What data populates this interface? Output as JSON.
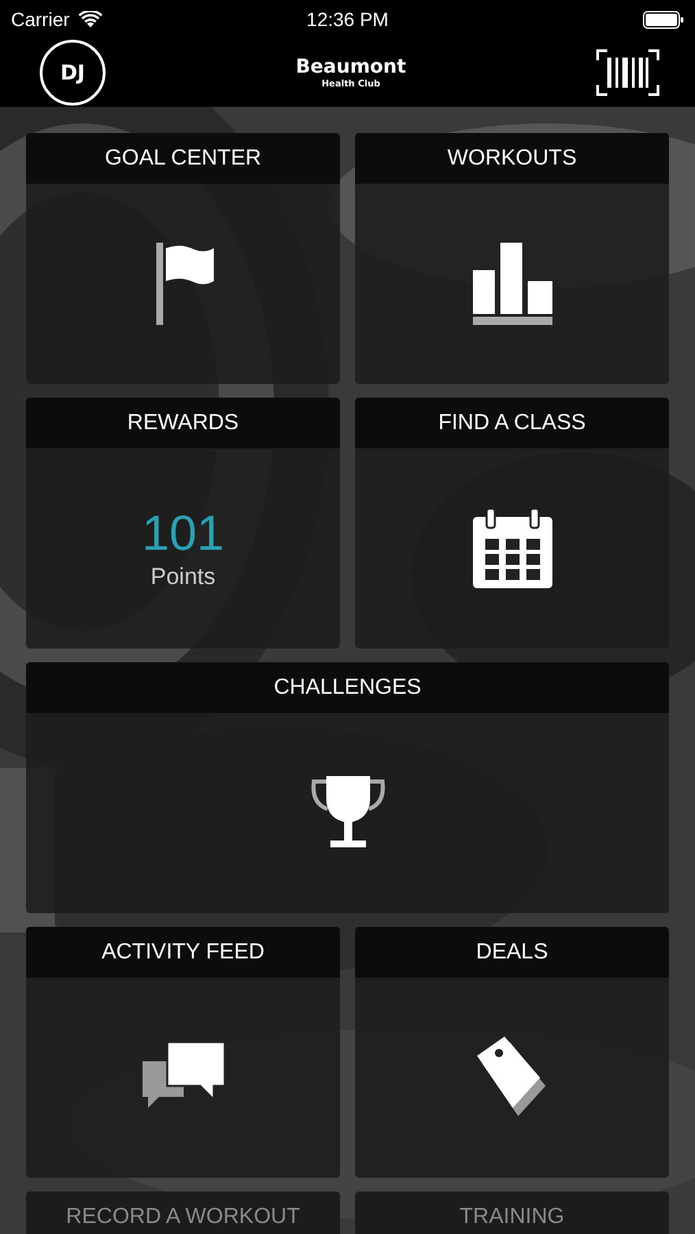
{
  "status_bar": {
    "carrier": "Carrier",
    "time": "12:36 PM"
  },
  "nav_bar": {
    "avatar": "DJ",
    "title": "Beaumont",
    "subtitle": "Health Club"
  },
  "tiles": [
    {
      "title": "GOAL CENTER",
      "kind": "icon",
      "wide": false
    },
    {
      "title": "WORKOUTS",
      "kind": "icon",
      "wide": false
    },
    {
      "title": "REWARDS",
      "kind": "points",
      "wide": false,
      "value": "101",
      "unit": "Points"
    },
    {
      "title": "FIND A CLASS",
      "kind": "icon",
      "wide": false
    },
    {
      "title": "CHALLENGES",
      "kind": "icon",
      "wide": true
    },
    {
      "title": "ACTIVITY FEED",
      "kind": "icon",
      "wide": false
    },
    {
      "title": "DEALS",
      "kind": "icon",
      "wide": false
    },
    {
      "title": "RECORD A WORKOUT",
      "kind": "cut",
      "wide": false
    },
    {
      "title": "TRAINING",
      "kind": "cut",
      "wide": false
    }
  ]
}
